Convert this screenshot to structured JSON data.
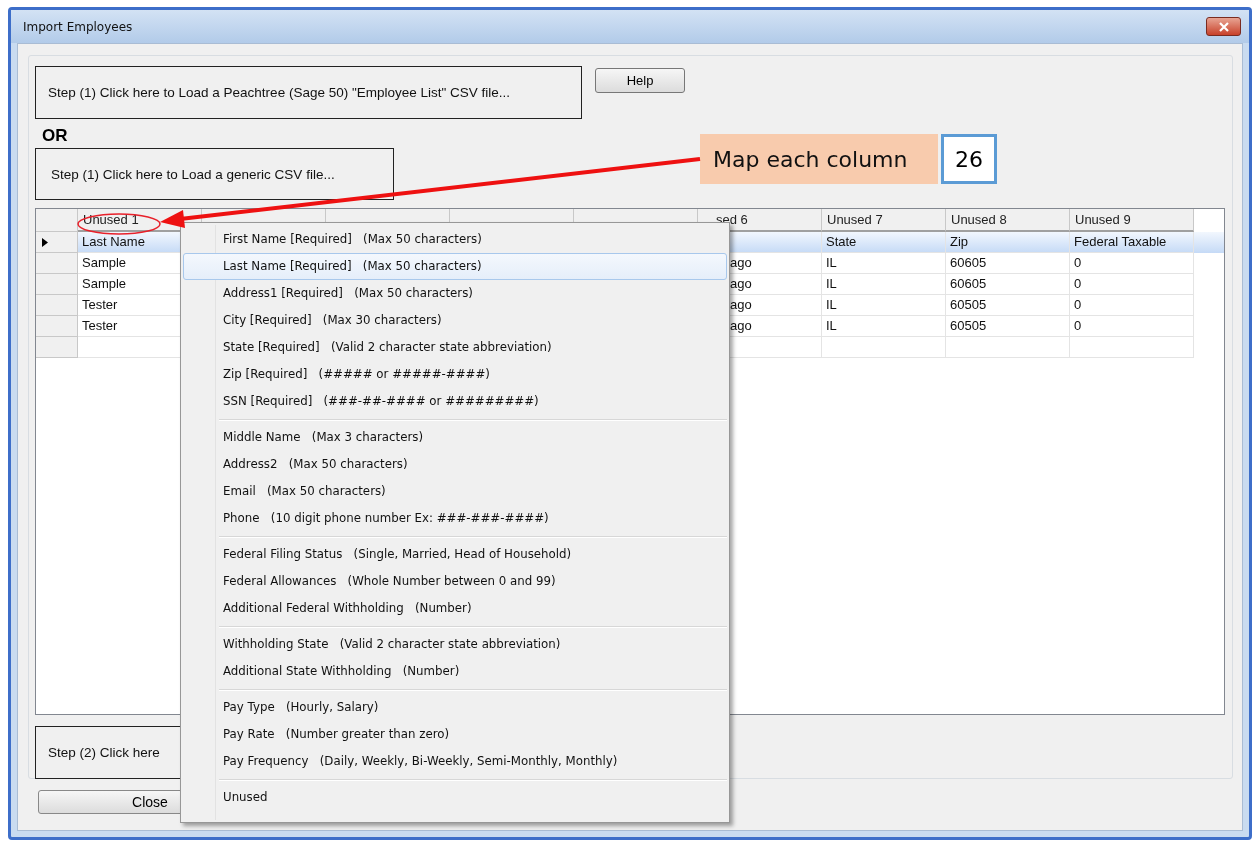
{
  "window": {
    "title": "Import Employees"
  },
  "buttons": {
    "load_peachtree": "Step (1) Click here to Load a Peachtree (Sage 50) \"Employee List\" CSV file...",
    "help": "Help",
    "or_label": "OR",
    "load_generic": "Step (1) Click here to Load a  generic CSV file...",
    "step2": "Step (2) Click here",
    "close": "Close"
  },
  "grid": {
    "columns": [
      {
        "kind": "text",
        "label": "Unused 1"
      },
      {
        "kind": "covered"
      },
      {
        "kind": "covered"
      },
      {
        "kind": "covered"
      },
      {
        "kind": "covered"
      },
      {
        "kind": "partial",
        "label": "sed 6"
      },
      {
        "kind": "text",
        "label": "Unused 7"
      },
      {
        "kind": "text",
        "label": "Unused 8"
      },
      {
        "kind": "text",
        "label": "Unused 9"
      }
    ],
    "rows": [
      {
        "selected": true,
        "current": true,
        "cells": [
          "Last Name",
          "State",
          "Zip",
          "Federal Taxable"
        ]
      },
      {
        "selected": false,
        "current": false,
        "cells": [
          "Sample",
          "IL",
          "60605",
          "0"
        ],
        "column_6": "ago"
      },
      {
        "selected": false,
        "current": false,
        "cells": [
          "Sample",
          "IL",
          "60605",
          "0"
        ],
        "column_6": "ago"
      },
      {
        "selected": false,
        "current": false,
        "cells": [
          "Tester",
          "IL",
          "60505",
          "0"
        ],
        "column_6": "ago"
      },
      {
        "selected": false,
        "current": false,
        "cells": [
          "Tester",
          "IL",
          "60505",
          "0"
        ],
        "column_6": "ago"
      }
    ],
    "new_row": true
  },
  "menu": {
    "groups": [
      {
        "items": [
          {
            "label": "First Name [Required]",
            "hint": "(Max 50 characters)",
            "selected": false
          },
          {
            "label": "Last Name [Required]",
            "hint": "(Max 50 characters)",
            "selected": true
          },
          {
            "label": "Address1 [Required]",
            "hint": "(Max 50 characters)",
            "selected": false
          },
          {
            "label": "City [Required]",
            "hint": "(Max 30 characters)",
            "selected": false
          },
          {
            "label": "State [Required]",
            "hint": "(Valid 2 character state abbreviation)",
            "selected": false
          },
          {
            "label": "Zip [Required]",
            "hint": "(##### or #####-####)",
            "selected": false
          },
          {
            "label": "SSN [Required]",
            "hint": "(###-##-#### or #########)",
            "selected": false
          }
        ]
      },
      {
        "items": [
          {
            "label": "Middle Name",
            "hint": "(Max 3 characters)",
            "selected": false
          },
          {
            "label": "Address2",
            "hint": "(Max 50 characters)",
            "selected": false
          },
          {
            "label": "Email",
            "hint": "(Max 50 characters)",
            "selected": false
          },
          {
            "label": "Phone",
            "hint": "(10 digit phone number Ex: ###-###-####)",
            "selected": false
          }
        ]
      },
      {
        "items": [
          {
            "label": "Federal Filing Status",
            "hint": "(Single, Married, Head of Household)",
            "selected": false
          },
          {
            "label": "Federal Allowances",
            "hint": "(Whole Number between 0 and 99)",
            "selected": false
          },
          {
            "label": "Additional Federal Withholding",
            "hint": "(Number)",
            "selected": false
          }
        ]
      },
      {
        "items": [
          {
            "label": "Withholding State",
            "hint": "(Valid 2 character state abbreviation)",
            "selected": false
          },
          {
            "label": "Additional State Withholding",
            "hint": "(Number)",
            "selected": false
          }
        ]
      },
      {
        "items": [
          {
            "label": "Pay Type",
            "hint": "(Hourly, Salary)",
            "selected": false
          },
          {
            "label": "Pay Rate",
            "hint": "(Number greater than zero)",
            "selected": false
          },
          {
            "label": "Pay Frequency",
            "hint": "(Daily, Weekly, Bi-Weekly, Semi-Monthly, Monthly)",
            "selected": false
          }
        ]
      },
      {
        "items": [
          {
            "label": "Unused",
            "selected": false
          }
        ]
      }
    ]
  },
  "callout": {
    "text": "Map each column",
    "count": "26"
  }
}
